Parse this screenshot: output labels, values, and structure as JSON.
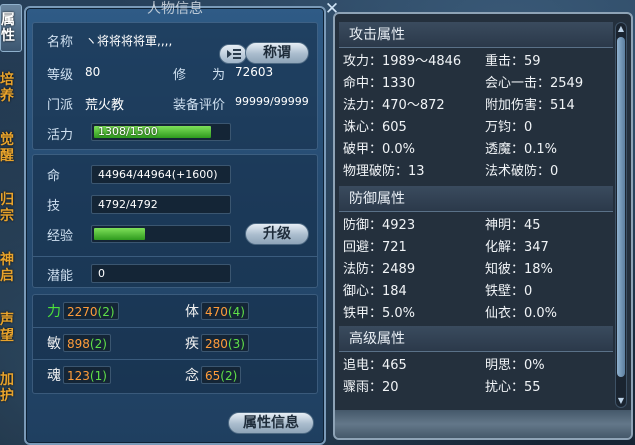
{
  "window": {
    "title": "人物信息"
  },
  "side_tabs": [
    {
      "label": "属性",
      "active": true
    },
    {
      "label": "培养",
      "active": false
    },
    {
      "label": "觉醒",
      "active": false
    },
    {
      "label": "归宗",
      "active": false
    },
    {
      "label": "神启",
      "active": false
    },
    {
      "label": "声望",
      "active": false
    },
    {
      "label": "加护",
      "active": false
    }
  ],
  "info": {
    "name_label": "名称",
    "name_value": "ヽ将将将将軍,,,,",
    "title_button": "称谓",
    "level_label": "等级",
    "level_value": "80",
    "cultivation_label": "修　　为",
    "cultivation_value": "72603",
    "faction_label": "门派",
    "faction_value": "荒火教",
    "gear_score_label": "装备评价",
    "gear_score_value": "99999/99999",
    "vitality_label": "活力",
    "vitality_value": "1308/1500",
    "vitality_fraction": 0.872
  },
  "resources": {
    "hp_label": "命",
    "hp_value": "44964/44964(+1600)",
    "skill_label": "技",
    "skill_value": "4792/4792",
    "exp_label": "经验",
    "exp_fraction": 0.38,
    "upgrade_button": "升级"
  },
  "potential": {
    "label": "潜能",
    "value": "0"
  },
  "stats": [
    {
      "key": "力",
      "base": "2270",
      "bonus": "(2)",
      "highlight": true
    },
    {
      "key": "体",
      "base": "470",
      "bonus": "(4)",
      "highlight": false
    },
    {
      "key": "敏",
      "base": "898",
      "bonus": "(2)",
      "highlight": false
    },
    {
      "key": "疾",
      "base": "280",
      "bonus": "(3)",
      "highlight": false
    },
    {
      "key": "魂",
      "base": "123",
      "bonus": "(1)",
      "highlight": false
    },
    {
      "key": "念",
      "base": "65",
      "bonus": "(2)",
      "highlight": false
    }
  ],
  "footer": {
    "attr_info_button": "属性信息"
  },
  "attack": {
    "header": "攻击属性",
    "rows": [
      [
        "攻力：1989～4846",
        "重击：59"
      ],
      [
        "命中：1330",
        "会心一击：2549"
      ],
      [
        "法力：470～872",
        "附加伤害：514"
      ],
      [
        "诛心：605",
        "万钧：0"
      ],
      [
        "破甲：0.0%",
        "透魔：0.1%"
      ],
      [
        "物理破防：13",
        "法术破防：0"
      ]
    ]
  },
  "defense": {
    "header": "防御属性",
    "rows": [
      [
        "防御：4923",
        "神明：45"
      ],
      [
        "回避：721",
        "化解：347"
      ],
      [
        "法防：2489",
        "知彼：18%"
      ],
      [
        "御心：184",
        "铁壁：0"
      ],
      [
        "铁甲：5.0%",
        "仙衣：0.0%"
      ]
    ]
  },
  "advanced": {
    "header": "高级属性",
    "rows": [
      [
        "追电：465",
        "明思：0%"
      ],
      [
        "骤雨：20",
        "扰心：55"
      ]
    ]
  },
  "colors": {
    "accent_orange": "#e8a32c",
    "stat_base": "#ff9c3a",
    "stat_bonus": "#5fe048",
    "highlight_green": "#4de23a"
  }
}
